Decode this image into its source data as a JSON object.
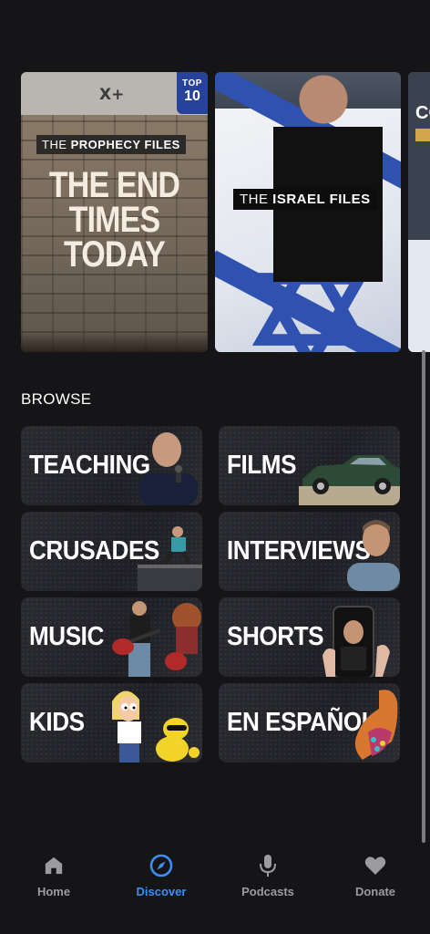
{
  "featured": {
    "card1": {
      "badge_top": "TOP",
      "badge_num": "10",
      "series_prefix": "THE",
      "series_name": "PROPHECY FILES",
      "title_line1": "THE END",
      "title_line2": "TIMES",
      "title_line3": "TODAY",
      "logo": "X+"
    },
    "card2": {
      "series_prefix": "THE",
      "series_name": "ISRAEL FILES"
    },
    "card3": {
      "title_fragment": "CO"
    }
  },
  "browse": {
    "title": "BROWSE",
    "tiles": [
      {
        "label": "TEACHING"
      },
      {
        "label": "FILMS"
      },
      {
        "label": "CRUSADES"
      },
      {
        "label": "INTERVIEWS"
      },
      {
        "label": "MUSIC"
      },
      {
        "label": "SHORTS"
      },
      {
        "label": "KIDS"
      },
      {
        "label": "EN ESPAÑOL"
      }
    ]
  },
  "nav": {
    "items": [
      {
        "label": "Home",
        "icon": "home-icon"
      },
      {
        "label": "Discover",
        "icon": "compass-icon",
        "active": true
      },
      {
        "label": "Podcasts",
        "icon": "microphone-icon"
      },
      {
        "label": "Donate",
        "icon": "heart-icon"
      }
    ],
    "active_color": "#3b8ff2",
    "inactive_color": "#9c9ca0"
  }
}
